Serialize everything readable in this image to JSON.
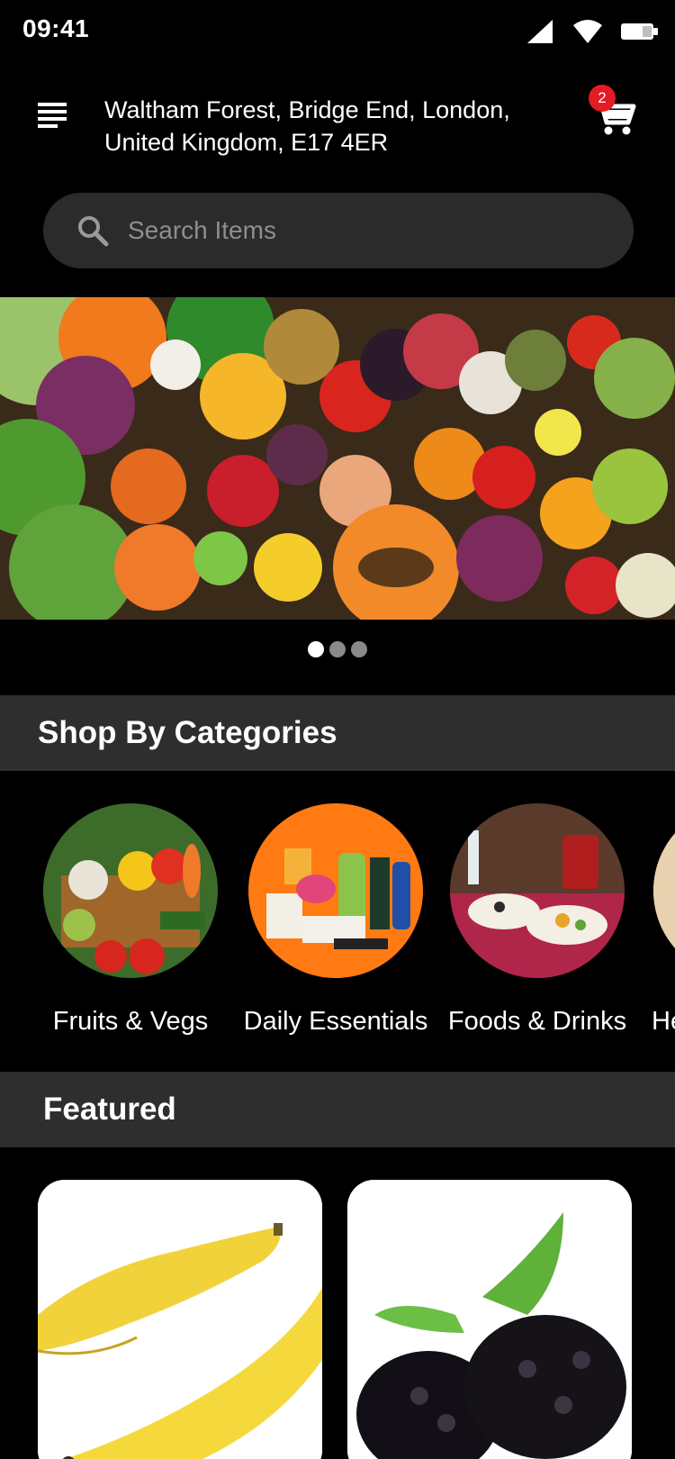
{
  "status": {
    "time": "09:41"
  },
  "header": {
    "address": "Waltham Forest, Bridge End, London, United Kingdom, E17 4ER",
    "cart_count": "2"
  },
  "search": {
    "placeholder": "Search Items"
  },
  "banner": {
    "slides": 3,
    "active_slide": 1
  },
  "categories": {
    "title": "Shop By Categories",
    "items": [
      {
        "label": "Fruits & Vegs"
      },
      {
        "label": "Daily Essentials"
      },
      {
        "label": "Foods & Drinks"
      },
      {
        "label": "He"
      }
    ]
  },
  "featured": {
    "title": "Featured",
    "items": [
      {
        "icon": "banana-image"
      },
      {
        "icon": "blackberry-image"
      }
    ]
  },
  "colors": {
    "accent": "#e31b23",
    "background": "#000000",
    "panel": "#2e2e2e",
    "search_bg": "#2b2b2b"
  }
}
